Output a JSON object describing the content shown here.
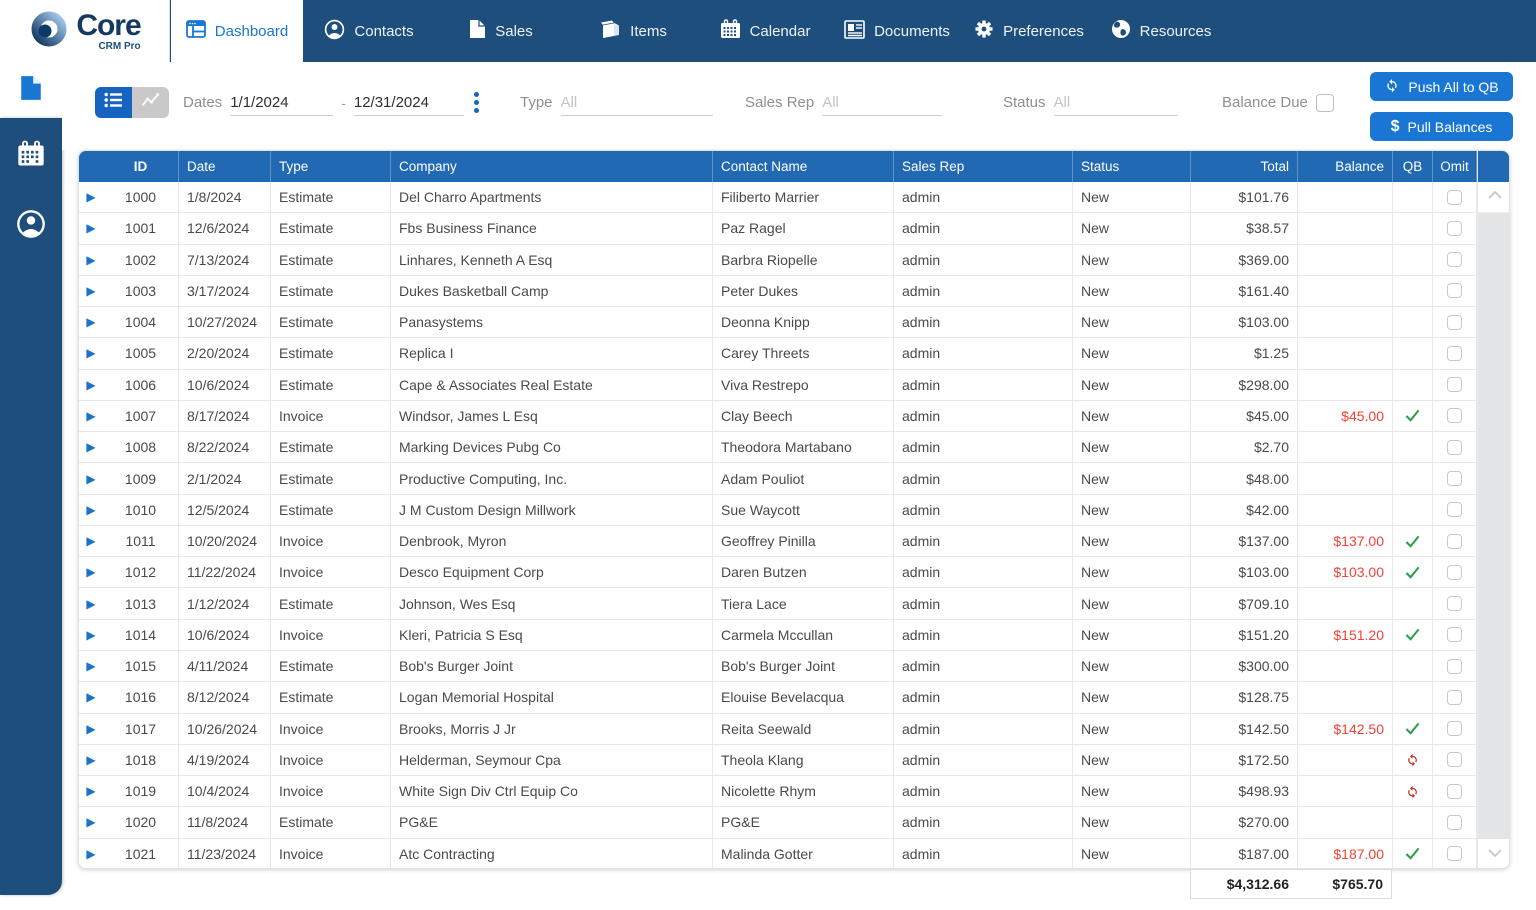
{
  "brand": {
    "name": "Core",
    "sub": "CRM Pro"
  },
  "nav": {
    "tabs": [
      {
        "label": "Dashboard",
        "active": true
      },
      {
        "label": "Contacts"
      },
      {
        "label": "Sales"
      },
      {
        "label": "Items"
      },
      {
        "label": "Calendar"
      },
      {
        "label": "Documents"
      },
      {
        "label": "Preferences"
      },
      {
        "label": "Resources"
      }
    ]
  },
  "filters": {
    "dates_label": "Dates",
    "date_from": "1/1/2024",
    "date_sep": "-",
    "date_to": "12/31/2024",
    "type_label": "Type",
    "type_placeholder": "All",
    "sales_rep_label": "Sales Rep",
    "sales_rep_placeholder": "All",
    "status_label": "Status",
    "status_placeholder": "All",
    "balance_due_label": "Balance Due",
    "push_qb_label": "Push All to QB",
    "pull_balances_label": "Pull Balances"
  },
  "table": {
    "columns": {
      "id": "ID",
      "date": "Date",
      "type": "Type",
      "company": "Company",
      "contact": "Contact Name",
      "rep": "Sales Rep",
      "status": "Status",
      "total": "Total",
      "balance": "Balance",
      "qb": "QB",
      "omit": "Omit"
    },
    "rows": [
      {
        "id": "1000",
        "date": "1/8/2024",
        "type": "Estimate",
        "company": "Del Charro Apartments",
        "contact": "Filiberto Marrier",
        "rep": "admin",
        "status": "New",
        "total": "$101.76",
        "balance": "",
        "qb": ""
      },
      {
        "id": "1001",
        "date": "12/6/2024",
        "type": "Estimate",
        "company": "Fbs Business Finance",
        "contact": "Paz Ragel",
        "rep": "admin",
        "status": "New",
        "total": "$38.57",
        "balance": "",
        "qb": ""
      },
      {
        "id": "1002",
        "date": "7/13/2024",
        "type": "Estimate",
        "company": "Linhares, Kenneth A Esq",
        "contact": "Barbra Riopelle",
        "rep": "admin",
        "status": "New",
        "total": "$369.00",
        "balance": "",
        "qb": ""
      },
      {
        "id": "1003",
        "date": "3/17/2024",
        "type": "Estimate",
        "company": "Dukes Basketball Camp",
        "contact": "Peter Dukes",
        "rep": "admin",
        "status": "New",
        "total": "$161.40",
        "balance": "",
        "qb": ""
      },
      {
        "id": "1004",
        "date": "10/27/2024",
        "type": "Estimate",
        "company": "Panasystems",
        "contact": "Deonna Knipp",
        "rep": "admin",
        "status": "New",
        "total": "$103.00",
        "balance": "",
        "qb": ""
      },
      {
        "id": "1005",
        "date": "2/20/2024",
        "type": "Estimate",
        "company": "Replica I",
        "contact": "Carey Threets",
        "rep": "admin",
        "status": "New",
        "total": "$1.25",
        "balance": "",
        "qb": ""
      },
      {
        "id": "1006",
        "date": "10/6/2024",
        "type": "Estimate",
        "company": "Cape & Associates Real Estate",
        "contact": "Viva Restrepo",
        "rep": "admin",
        "status": "New",
        "total": "$298.00",
        "balance": "",
        "qb": ""
      },
      {
        "id": "1007",
        "date": "8/17/2024",
        "type": "Invoice",
        "company": "Windsor, James L Esq",
        "contact": "Clay Beech",
        "rep": "admin",
        "status": "New",
        "total": "$45.00",
        "balance": "$45.00",
        "qb": "check"
      },
      {
        "id": "1008",
        "date": "8/22/2024",
        "type": "Estimate",
        "company": "Marking Devices Pubg Co",
        "contact": "Theodora Martabano",
        "rep": "admin",
        "status": "New",
        "total": "$2.70",
        "balance": "",
        "qb": ""
      },
      {
        "id": "1009",
        "date": "2/1/2024",
        "type": "Estimate",
        "company": "Productive Computing, Inc.",
        "contact": "Adam Pouliot",
        "rep": "admin",
        "status": "New",
        "total": "$48.00",
        "balance": "",
        "qb": ""
      },
      {
        "id": "1010",
        "date": "12/5/2024",
        "type": "Estimate",
        "company": "J M Custom Design Millwork",
        "contact": "Sue Waycott",
        "rep": "admin",
        "status": "New",
        "total": "$42.00",
        "balance": "",
        "qb": ""
      },
      {
        "id": "1011",
        "date": "10/20/2024",
        "type": "Invoice",
        "company": "Denbrook, Myron",
        "contact": "Geoffrey Pinilla",
        "rep": "admin",
        "status": "New",
        "total": "$137.00",
        "balance": "$137.00",
        "qb": "check"
      },
      {
        "id": "1012",
        "date": "11/22/2024",
        "type": "Invoice",
        "company": "Desco Equipment Corp",
        "contact": "Daren Butzen",
        "rep": "admin",
        "status": "New",
        "total": "$103.00",
        "balance": "$103.00",
        "qb": "check"
      },
      {
        "id": "1013",
        "date": "1/12/2024",
        "type": "Estimate",
        "company": "Johnson, Wes Esq",
        "contact": "Tiera Lace",
        "rep": "admin",
        "status": "New",
        "total": "$709.10",
        "balance": "",
        "qb": ""
      },
      {
        "id": "1014",
        "date": "10/6/2024",
        "type": "Invoice",
        "company": "Kleri, Patricia S Esq",
        "contact": "Carmela Mccullan",
        "rep": "admin",
        "status": "New",
        "total": "$151.20",
        "balance": "$151.20",
        "qb": "check"
      },
      {
        "id": "1015",
        "date": "4/11/2024",
        "type": "Estimate",
        "company": "Bob's Burger Joint",
        "contact": "Bob's Burger Joint",
        "rep": "admin",
        "status": "New",
        "total": "$300.00",
        "balance": "",
        "qb": ""
      },
      {
        "id": "1016",
        "date": "8/12/2024",
        "type": "Estimate",
        "company": "Logan Memorial Hospital",
        "contact": "Elouise Bevelacqua",
        "rep": "admin",
        "status": "New",
        "total": "$128.75",
        "balance": "",
        "qb": ""
      },
      {
        "id": "1017",
        "date": "10/26/2024",
        "type": "Invoice",
        "company": "Brooks, Morris J Jr",
        "contact": "Reita Seewald",
        "rep": "admin",
        "status": "New",
        "total": "$142.50",
        "balance": "$142.50",
        "qb": "check"
      },
      {
        "id": "1018",
        "date": "4/19/2024",
        "type": "Invoice",
        "company": "Helderman, Seymour Cpa",
        "contact": "Theola Klang",
        "rep": "admin",
        "status": "New",
        "total": "$172.50",
        "balance": "",
        "qb": "sync"
      },
      {
        "id": "1019",
        "date": "10/4/2024",
        "type": "Invoice",
        "company": "White Sign Div Ctrl Equip Co",
        "contact": "Nicolette Rhym",
        "rep": "admin",
        "status": "New",
        "total": "$498.93",
        "balance": "",
        "qb": "sync"
      },
      {
        "id": "1020",
        "date": "11/8/2024",
        "type": "Estimate",
        "company": "PG&E",
        "contact": "PG&E",
        "rep": "admin",
        "status": "New",
        "total": "$270.00",
        "balance": "",
        "qb": ""
      },
      {
        "id": "1021",
        "date": "11/23/2024",
        "type": "Invoice",
        "company": "Atc Contracting",
        "contact": "Malinda Gotter",
        "rep": "admin",
        "status": "New",
        "total": "$187.00",
        "balance": "$187.00",
        "qb": "check"
      }
    ],
    "footer": {
      "total": "$4,312.66",
      "balance": "$765.70"
    }
  },
  "colors": {
    "nav": "#1d4e7c",
    "header": "#2269b3",
    "accent": "#1976d2",
    "balance_red": "#f44336",
    "check_green": "#2e9e4a",
    "sync_red": "#c0392b"
  }
}
